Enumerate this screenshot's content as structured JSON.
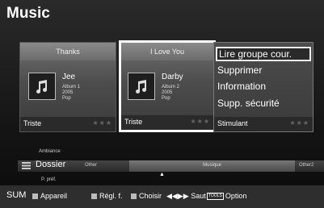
{
  "title": "Music",
  "cards": [
    {
      "header": "Thanks",
      "artist": "Jee",
      "album": "Album 1",
      "year": "2005",
      "genre": "Pop",
      "mood": "Triste",
      "stars": "★★★"
    },
    {
      "header": "I Love You",
      "artist": "Darby",
      "album": "Album 2",
      "year": "2005",
      "genre": "Pop",
      "mood": "Triste",
      "stars": "★★★"
    }
  ],
  "menu": {
    "items": [
      "Lire groupe cour.",
      "Supprimer",
      "Information",
      "Supp. sécurité"
    ],
    "mood": "Stimulant",
    "stars": "★★★"
  },
  "category": {
    "ambiance": "Ambiance",
    "dossier": "Dossier",
    "other_left": "Other",
    "musique": "Musique",
    "other_right": "Other2",
    "ppref": "P. préf."
  },
  "help": {
    "sum": "SUM",
    "appareil": "Appareil",
    "regl": "Régl. f.",
    "choisir": "Choisir",
    "saut": "Saut",
    "tools": "TOOLS",
    "option": "Option"
  },
  "icons": {
    "music": "music-note-icon",
    "dossier": "folder-icon",
    "arrow": "up-arrow-icon",
    "skip": "skip-icon"
  }
}
